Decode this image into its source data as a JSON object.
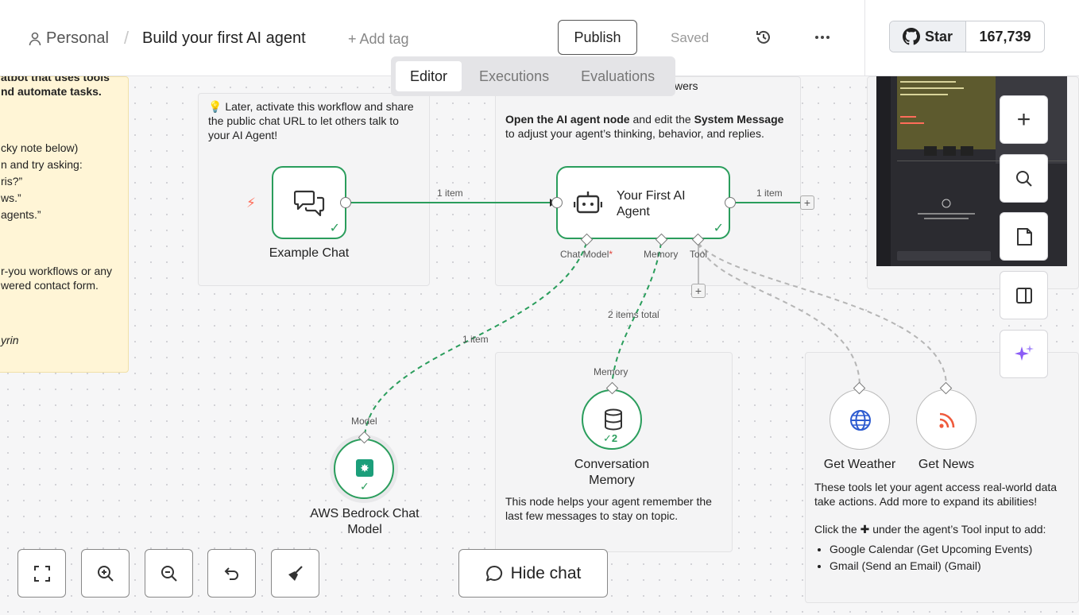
{
  "header": {
    "project": "Personal",
    "workflow_name": "Build your first AI agent",
    "add_tag": "+ Add tag",
    "publish_label": "Publish",
    "saved_label": "Saved",
    "github_star_label": "Star",
    "github_star_count": "167,739"
  },
  "tabs": [
    {
      "label": "Editor",
      "active": true
    },
    {
      "label": "Executions",
      "active": false
    },
    {
      "label": "Evaluations",
      "active": false
    }
  ],
  "sticky_yellow": {
    "lines": [
      "atbot that uses tools",
      "nd automate tasks.",
      "cky note below)",
      "n and try asking:",
      "ris?”",
      "ws.”",
      "agents.”",
      "r-you workflows or any",
      "wered contact form.",
      "yrin"
    ]
  },
  "notes": {
    "chat_note": "💡 Later, activate this workflow and share the public chat URL to let others talk to your AI Agent!",
    "agent_note_top": "wers",
    "agent_note_prefix_bold": "Open the AI agent node",
    "agent_note_mid": " and edit the ",
    "agent_note_bold2": "System Message",
    "agent_note_suffix": " to adjust your agent’s thinking, behavior, and replies.",
    "memory_note": "This node helps your agent remember the last few messages to stay on topic.",
    "tools_note": "These tools let your agent access real-world data take actions. Add more to expand its abilities!",
    "tools_click_prefix": "Click the",
    "tools_click_suffix": "under the agent’s Tool input to add:",
    "tools_list": [
      "Google Calendar (Get Upcoming Events)",
      "Gmail (Send an Email) (Gmail)"
    ]
  },
  "nodes": {
    "example_chat": "Example Chat",
    "agent": "Your First AI Agent",
    "bedrock": "AWS Bedrock Chat Model",
    "memory": "Conversation Memory",
    "memory_count": "2",
    "weather": "Get Weather",
    "news": "Get News"
  },
  "ports": {
    "chat_model": "Chat Model",
    "chat_model_required": "*",
    "memory": "Memory",
    "tool": "Tool",
    "model": "Model",
    "memory_in": "Memory"
  },
  "edges": {
    "chat_to_agent": "1 item",
    "agent_out": "1 item",
    "bedrock_edge": "1 item",
    "memory_edge": "2 items total"
  },
  "bottom": {
    "hide_chat_label": "Hide chat"
  },
  "colors": {
    "accent_green": "#2a9d5c",
    "sticky_yellow": "#fff5d6",
    "trigger_orange": "#ff6d5a"
  }
}
